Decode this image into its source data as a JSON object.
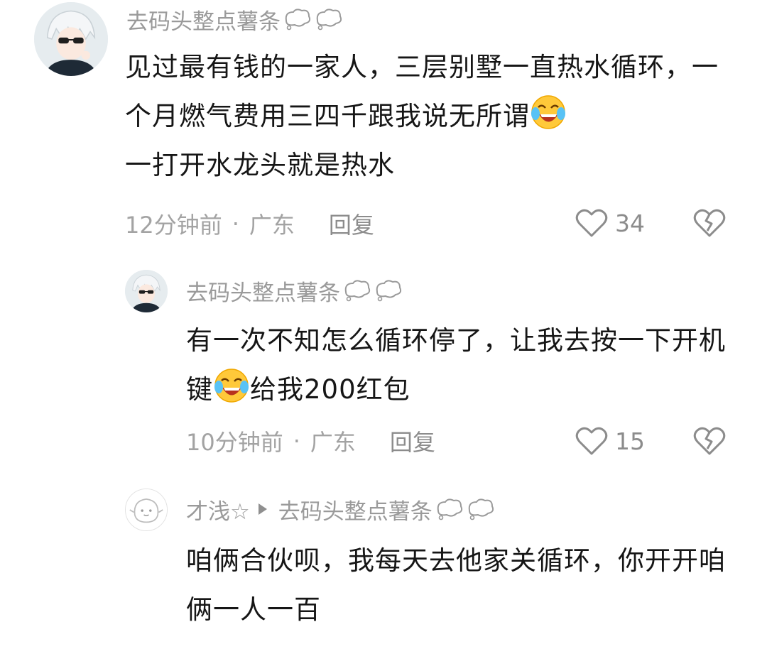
{
  "comments": [
    {
      "user": "去码头整点薯条",
      "text_part1": "见过最有钱的一家人，三层别墅一直热水循环，一个月燃气费用三四千跟我说无所谓",
      "text_part2": "一打开水龙头就是热水",
      "time": "12分钟前",
      "dot": "·",
      "location": "广东",
      "reply": "回复",
      "likes": "34"
    },
    {
      "user": "去码头整点薯条",
      "text_part1": "有一次不知怎么循环停了，让我去按一下开机键",
      "text_part2": "给我200红包",
      "time": "10分钟前",
      "dot": "·",
      "location": "广东",
      "reply": "回复",
      "likes": "15"
    },
    {
      "user": "才浅☆",
      "reply_to": "去码头整点薯条",
      "text": "咱俩合伙呗，我每天去他家关循环，你开开咱俩一人一百"
    }
  ],
  "icons": {
    "like": "heart-outline-icon",
    "dislike": "broken-heart-icon",
    "emoji": "laugh-cry-emoji",
    "bubble": "thought-bubble-icon",
    "reply_arrow": "play-arrow-icon"
  }
}
